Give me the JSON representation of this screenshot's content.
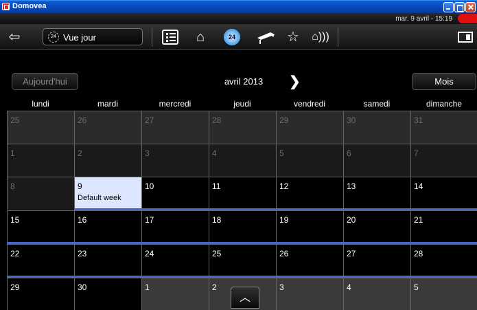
{
  "window": {
    "title": "Domovea"
  },
  "status": {
    "datetime": "mar. 9 avril - 15:19"
  },
  "toolbar": {
    "view_label": "Vue jour",
    "clock_label": "24",
    "clock24_label": "24"
  },
  "nav": {
    "today_label": "Aujourd'hui",
    "month_title": "avril 2013",
    "next_label": "❯",
    "mode_label": "Mois"
  },
  "weekdays": [
    "lundi",
    "mardi",
    "mercredi",
    "jeudi",
    "vendredi",
    "samedi",
    "dimanche"
  ],
  "weeks": [
    [
      "25",
      "26",
      "27",
      "28",
      "29",
      "30",
      "31"
    ],
    [
      "1",
      "2",
      "3",
      "4",
      "5",
      "6",
      "7"
    ],
    [
      "8",
      "9",
      "10",
      "11",
      "12",
      "13",
      "14"
    ],
    [
      "15",
      "16",
      "17",
      "18",
      "19",
      "20",
      "21"
    ],
    [
      "22",
      "23",
      "24",
      "25",
      "26",
      "27",
      "28"
    ],
    [
      "29",
      "30",
      "1",
      "2",
      "3",
      "4",
      "5"
    ]
  ],
  "today_event": "Default week",
  "icons": {
    "back": "back-arrow-icon",
    "list": "list-icon",
    "home": "home-icon",
    "clock": "clock-24-icon",
    "camera": "camera-icon",
    "star": "star-icon",
    "alarm": "alarm-home-icon",
    "panel": "panel-toggle-icon",
    "scroll": "chevron-up-icon"
  },
  "colors": {
    "accent": "#4866c9",
    "today_bg": "#dde6ff",
    "alert": "#e01010"
  }
}
